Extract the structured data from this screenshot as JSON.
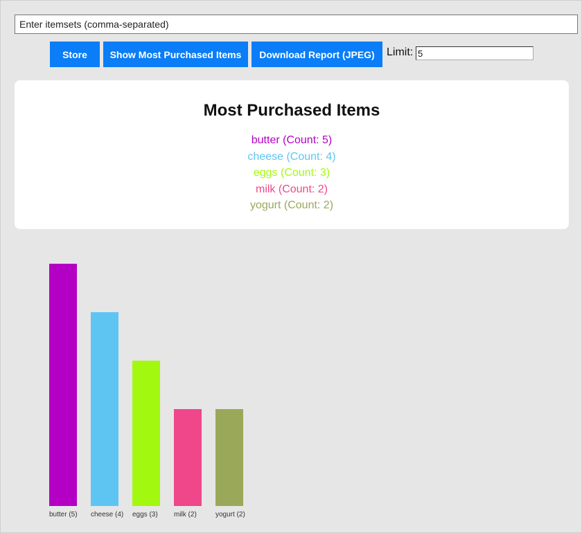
{
  "itemset_input": {
    "value": "",
    "placeholder": "Enter itemsets (comma-separated)"
  },
  "toolbar": {
    "store_label": "Store",
    "show_label": "Show Most Purchased Items",
    "download_label": "Download Report (JPEG)",
    "limit_label": "Limit:",
    "limit_value": "5"
  },
  "results": {
    "title": "Most Purchased Items",
    "items": [
      {
        "text": "butter (Count: 5)",
        "color": "#b300c4"
      },
      {
        "text": "cheese (Count: 4)",
        "color": "#5ec5f3"
      },
      {
        "text": "eggs (Count: 3)",
        "color": "#a3f80f"
      },
      {
        "text": "milk (Count: 2)",
        "color": "#ef478a"
      },
      {
        "text": "yogurt (Count: 2)",
        "color": "#9aa85a"
      }
    ]
  },
  "chart_data": {
    "type": "bar",
    "categories": [
      "butter (5)",
      "cheese (4)",
      "eggs (3)",
      "milk (2)",
      "yogurt (2)"
    ],
    "values": [
      5,
      4,
      3,
      2,
      2
    ],
    "colors": [
      "#b300c4",
      "#5ec5f3",
      "#a3f80f",
      "#ef478a",
      "#9aa85a"
    ],
    "title": "",
    "xlabel": "",
    "ylabel": "",
    "ylim": [
      0,
      5
    ],
    "grid": false
  }
}
